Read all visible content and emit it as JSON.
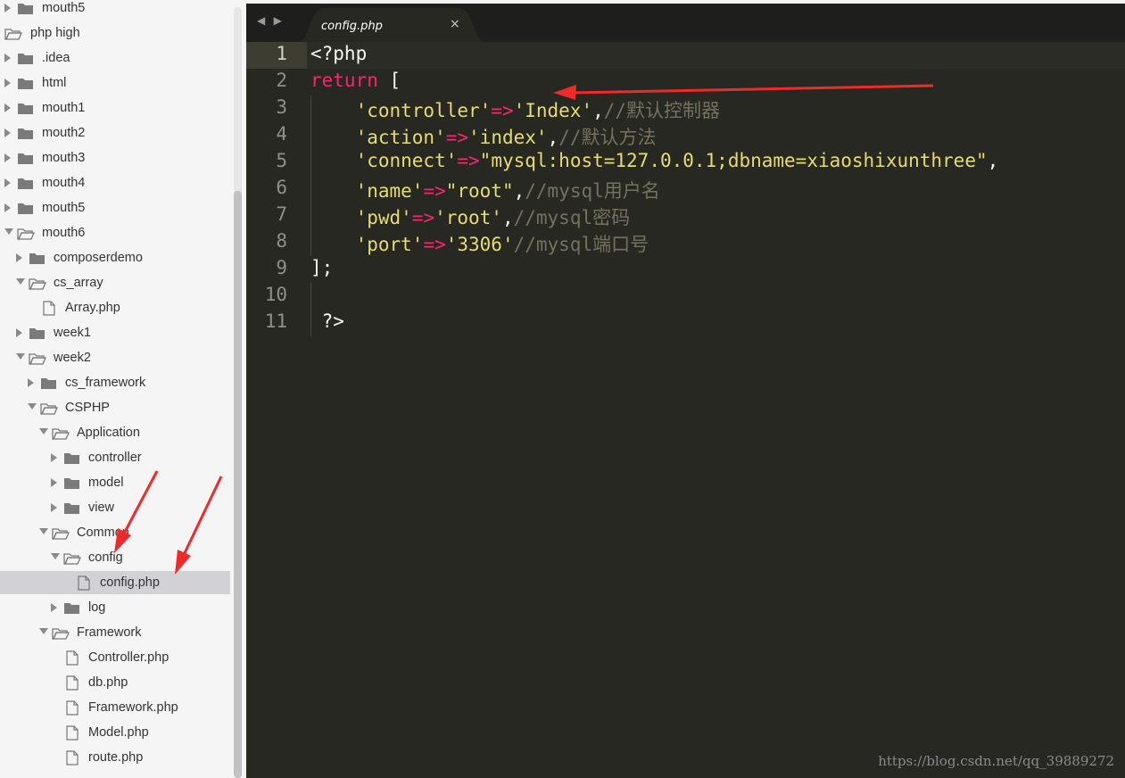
{
  "sidebar": {
    "items": [
      {
        "label": "mouth5",
        "depth": 0,
        "type": "folder",
        "expanded": false
      },
      {
        "label": "php high",
        "depth": 0,
        "type": "folder",
        "expanded": true,
        "no_arrow": true
      },
      {
        "label": ".idea",
        "depth": 0,
        "type": "folder",
        "expanded": false
      },
      {
        "label": "html",
        "depth": 0,
        "type": "folder",
        "expanded": false
      },
      {
        "label": "mouth1",
        "depth": 0,
        "type": "folder",
        "expanded": false
      },
      {
        "label": "mouth2",
        "depth": 0,
        "type": "folder",
        "expanded": false
      },
      {
        "label": "mouth3",
        "depth": 0,
        "type": "folder",
        "expanded": false
      },
      {
        "label": "mouth4",
        "depth": 0,
        "type": "folder",
        "expanded": false
      },
      {
        "label": "mouth5",
        "depth": 0,
        "type": "folder",
        "expanded": false
      },
      {
        "label": "mouth6",
        "depth": 0,
        "type": "folder",
        "expanded": true
      },
      {
        "label": "composerdemo",
        "depth": 1,
        "type": "folder",
        "expanded": false
      },
      {
        "label": "cs_array",
        "depth": 1,
        "type": "folder",
        "expanded": true
      },
      {
        "label": "Array.php",
        "depth": 2,
        "type": "file"
      },
      {
        "label": "week1",
        "depth": 1,
        "type": "folder",
        "expanded": false
      },
      {
        "label": "week2",
        "depth": 1,
        "type": "folder",
        "expanded": true
      },
      {
        "label": "cs_framework",
        "depth": 2,
        "type": "folder",
        "expanded": false
      },
      {
        "label": "CSPHP",
        "depth": 2,
        "type": "folder",
        "expanded": true
      },
      {
        "label": "Application",
        "depth": 3,
        "type": "folder",
        "expanded": true
      },
      {
        "label": "controller",
        "depth": 4,
        "type": "folder",
        "expanded": false
      },
      {
        "label": "model",
        "depth": 4,
        "type": "folder",
        "expanded": false
      },
      {
        "label": "view",
        "depth": 4,
        "type": "folder",
        "expanded": false
      },
      {
        "label": "Common",
        "depth": 3,
        "type": "folder",
        "expanded": true
      },
      {
        "label": "config",
        "depth": 4,
        "type": "folder",
        "expanded": true
      },
      {
        "label": "config.php",
        "depth": 5,
        "type": "file",
        "selected": true
      },
      {
        "label": "log",
        "depth": 4,
        "type": "folder",
        "expanded": false
      },
      {
        "label": "Framework",
        "depth": 3,
        "type": "folder",
        "expanded": true
      },
      {
        "label": "Controller.php",
        "depth": 4,
        "type": "file"
      },
      {
        "label": "db.php",
        "depth": 4,
        "type": "file"
      },
      {
        "label": "Framework.php",
        "depth": 4,
        "type": "file"
      },
      {
        "label": "Model.php",
        "depth": 4,
        "type": "file"
      },
      {
        "label": "route.php",
        "depth": 4,
        "type": "file"
      }
    ]
  },
  "editor": {
    "nav_arrows": "◀ ▶",
    "tab": {
      "label": "config.php",
      "close": "×"
    },
    "lines": [
      {
        "n": "1",
        "tokens": [
          {
            "t": "<?php",
            "c": "plain"
          }
        ]
      },
      {
        "n": "2",
        "tokens": [
          {
            "t": "return",
            "c": "kw"
          },
          {
            "t": " [",
            "c": "plain"
          }
        ]
      },
      {
        "n": "3",
        "tokens": [
          {
            "t": "    ",
            "c": "plain"
          },
          {
            "t": "'controller'",
            "c": "str"
          },
          {
            "t": "=>",
            "c": "kw"
          },
          {
            "t": "'Index'",
            "c": "str"
          },
          {
            "t": ",",
            "c": "plain"
          },
          {
            "t": "//默认控制器",
            "c": "cmt"
          }
        ]
      },
      {
        "n": "4",
        "tokens": [
          {
            "t": "    ",
            "c": "plain"
          },
          {
            "t": "'action'",
            "c": "str"
          },
          {
            "t": "=>",
            "c": "kw"
          },
          {
            "t": "'index'",
            "c": "str"
          },
          {
            "t": ",",
            "c": "plain"
          },
          {
            "t": "//默认方法",
            "c": "cmt"
          }
        ]
      },
      {
        "n": "5",
        "tokens": [
          {
            "t": "    ",
            "c": "plain"
          },
          {
            "t": "'connect'",
            "c": "str"
          },
          {
            "t": "=>",
            "c": "kw"
          },
          {
            "t": "\"mysql:host=127.0.0.1;dbname=xiaoshixunthree\"",
            "c": "str"
          },
          {
            "t": ",",
            "c": "plain"
          }
        ]
      },
      {
        "n": "6",
        "tokens": [
          {
            "t": "    ",
            "c": "plain"
          },
          {
            "t": "'name'",
            "c": "str"
          },
          {
            "t": "=>",
            "c": "kw"
          },
          {
            "t": "\"root\"",
            "c": "str"
          },
          {
            "t": ",",
            "c": "plain"
          },
          {
            "t": "//mysql用户名",
            "c": "cmt"
          }
        ]
      },
      {
        "n": "7",
        "tokens": [
          {
            "t": "    ",
            "c": "plain"
          },
          {
            "t": "'pwd'",
            "c": "str"
          },
          {
            "t": "=>",
            "c": "kw"
          },
          {
            "t": "'root'",
            "c": "str"
          },
          {
            "t": ",",
            "c": "plain"
          },
          {
            "t": "//mysql密码",
            "c": "cmt"
          }
        ]
      },
      {
        "n": "8",
        "tokens": [
          {
            "t": "    ",
            "c": "plain"
          },
          {
            "t": "'port'",
            "c": "str"
          },
          {
            "t": "=>",
            "c": "kw"
          },
          {
            "t": "'3306'",
            "c": "str"
          },
          {
            "t": "//mysql端口号",
            "c": "cmt"
          }
        ]
      },
      {
        "n": "9",
        "tokens": [
          {
            "t": "];",
            "c": "plain"
          }
        ]
      },
      {
        "n": "10",
        "tokens": []
      },
      {
        "n": "11",
        "tokens": [
          {
            "t": " ?>",
            "c": "plain"
          }
        ]
      }
    ]
  },
  "watermark": "https://blog.csdn.net/qq_39889272",
  "colors": {
    "annotation_red": "#ee2a2a",
    "editor_bg": "#272822",
    "sidebar_bg": "#f5f5f5"
  }
}
